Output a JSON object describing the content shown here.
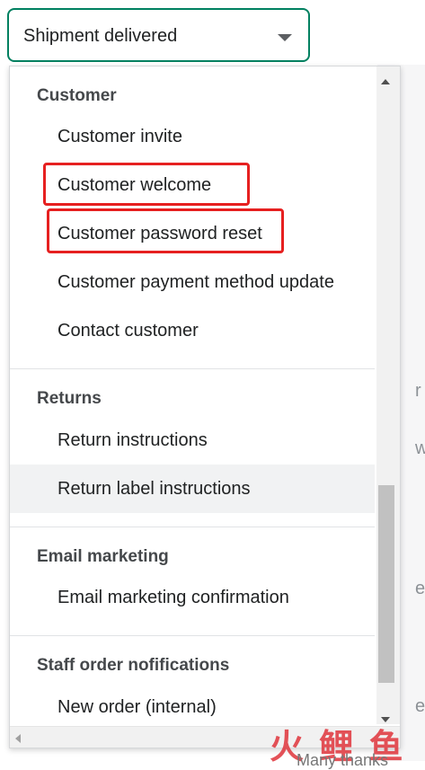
{
  "select": {
    "value": "Shipment delivered"
  },
  "background": {
    "ghost_chars": [
      "r",
      "w",
      "e",
      "e"
    ],
    "bottom_text": "Many thanks"
  },
  "sections": [
    {
      "title": "Customer",
      "items": [
        "Customer invite",
        "Customer welcome",
        "Customer password reset",
        "Customer payment method update",
        "Contact customer"
      ]
    },
    {
      "title": "Returns",
      "items": [
        "Return instructions",
        "Return label instructions"
      ]
    },
    {
      "title": "Email marketing",
      "items": [
        "Email marketing confirmation"
      ]
    },
    {
      "title": "Staff order nofifications",
      "items": [
        "New order (internal)"
      ]
    }
  ],
  "highlighted_items": [
    "Customer welcome",
    "Customer password reset"
  ],
  "hovered_item": "Return label instructions",
  "watermark": "火 鲤 鱼",
  "colors": {
    "accent": "#008060",
    "highlight": "#e62020"
  },
  "icons": {
    "select_caret": "chevron-down-icon"
  }
}
